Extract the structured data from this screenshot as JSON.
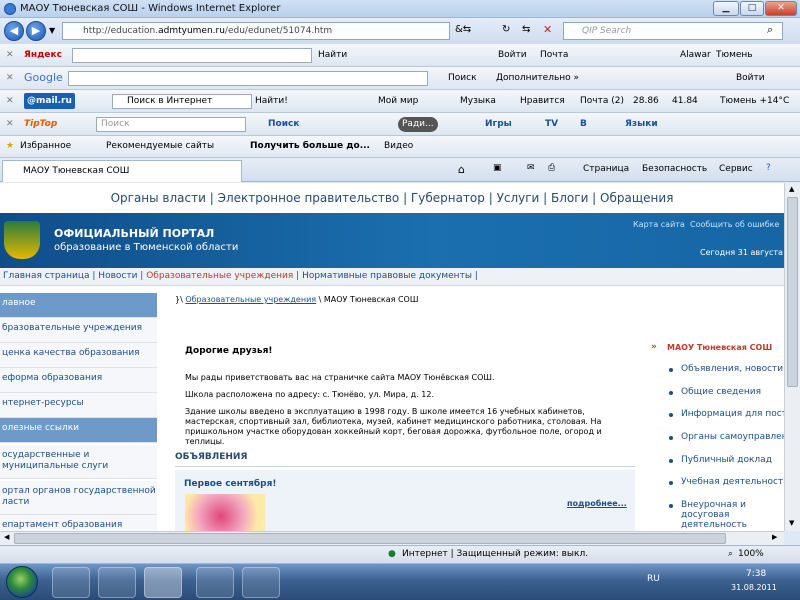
{
  "window": {
    "title": "МАОУ Тюневская СОШ - Windows Internet Explorer",
    "url_prefix": "http://education.",
    "url_domain": "admtyumen.ru",
    "url_path": "/edu/edunet/51074.htm",
    "search_placeholder": "QIP Search"
  },
  "toolbars": {
    "yandex": {
      "brand": "Яндекс",
      "find": "Найти",
      "login": "Войти",
      "mail": "Почта",
      "alawar": "Alawar",
      "city": "Тюмень"
    },
    "google": {
      "brand": "Google",
      "search": "Поиск",
      "more": "Дополнительно »",
      "login": "Войти"
    },
    "mailru": {
      "brand": "@mail.ru",
      "search_mode": "Поиск в Интернет",
      "find": "Найти!",
      "my_world": "Мой мир",
      "music": "Музыка",
      "like": "Нравится",
      "mail": "Почта (2)",
      "usd": "28.86",
      "eur": "41.84",
      "weather": "Тюмень +14°C"
    },
    "tiptop": {
      "brand": "TipTop",
      "search_placeholder": "Поиск",
      "search": "Поиск",
      "radio": "Ради...",
      "games": "Игры",
      "tv": "TV",
      "b": "B",
      "languages": "Языки"
    }
  },
  "favorites": {
    "label": "Избранное",
    "recommended": "Рекомендуемые сайты",
    "get_more": "Получить больше до...",
    "video": "Видео"
  },
  "tab": {
    "title": "МАОУ Тюневская СОШ"
  },
  "cmdbar": {
    "page": "Страница",
    "security": "Безопасность",
    "service": "Сервис"
  },
  "site": {
    "topnav": "Органы власти | Электронное правительство | Губернатор | Услуги | Блоги | Обращения",
    "portal_title": "ОФИЦИАЛЬНЫЙ ПОРТАЛ",
    "portal_subtitle": "образование в Тюменской области",
    "sitemap": "Карта сайта",
    "report_error": "Сообщить об ошибке",
    "today": "Сегодня 31 августа",
    "crumbs": [
      "Главная страница",
      "Новости",
      "Образовательные учреждения",
      "Нормативные правовые документы"
    ],
    "sidebar": [
      "лавное",
      "бразовательные учреждения",
      "ценка качества образования",
      "еформа образования",
      "нтернет-ресурсы",
      "олезные ссылки",
      "осударственные и муниципальные слуги",
      "ортал органов государственной ласти",
      "епартамент образования"
    ],
    "path_link": "Образовательные учреждения",
    "path_current": "\\ МАОУ Тюневская СОШ",
    "greeting": "Дорогие друзья!",
    "p1": "Мы рады приветствовать вас на страничке сайта МАОУ Тюнёвская СОШ.",
    "p2": "Школа расположена по адресу: с. Тюнёво, ул. Мира, д. 12.",
    "p3": "Здание школы введено в эксплуатацию в 1998 году. В школе имеется 16 учебных кабинетов, мастерская, спортивный зал, библиотека, музей, кабинет медицинского работника, столовая. На пришкольном участке оборудован хоккейный корт, беговая дорожка, футбольное поле, огород и теплицы.",
    "ads_heading": "ОБЪЯВЛЕНИЯ",
    "ad_title": "Первое сентября!",
    "ad_more": "подробнее...",
    "right_title": "МАОУ Тюневская СОШ",
    "right_items": [
      "Объявления, новости",
      "Общие сведения",
      "Информация для поступа",
      "Органы самоуправления",
      "Публичный доклад",
      "Учебная деятельность",
      "Внеурочная и досуговая деятельность"
    ]
  },
  "statusbar": {
    "zone": "Интернет | Защищенный режим: выкл.",
    "zoom": "100%"
  },
  "taskbar": {
    "lang": "RU",
    "time": "7:38",
    "date": "31.08.2011"
  }
}
